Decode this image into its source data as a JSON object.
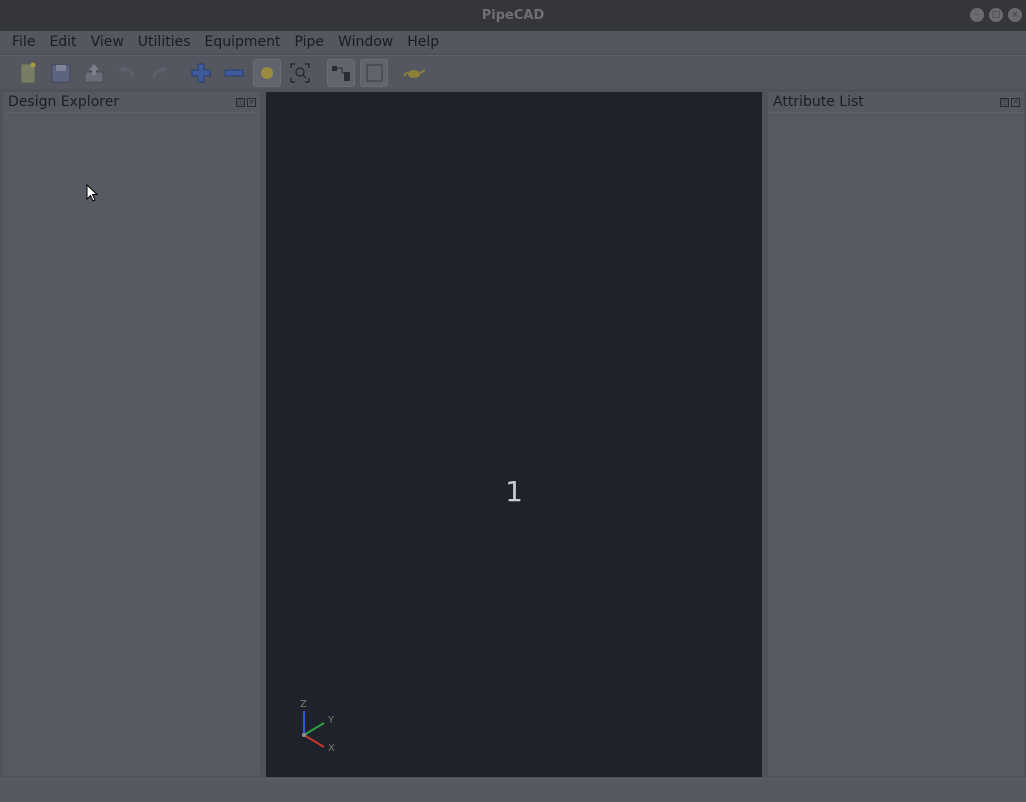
{
  "window": {
    "title": "PipeCAD",
    "controls": [
      "minimize",
      "maximize",
      "close"
    ]
  },
  "menubar": {
    "items": [
      "File",
      "Edit",
      "View",
      "Utilities",
      "Equipment",
      "Pipe",
      "Window",
      "Help"
    ]
  },
  "toolbar": {
    "buttons": [
      {
        "icon": "new-file-icon"
      },
      {
        "icon": "save-icon"
      },
      {
        "icon": "export-icon"
      },
      {
        "icon": "undo-icon"
      },
      {
        "icon": "redo-icon"
      },
      {
        "icon": "zoom-in-icon"
      },
      {
        "icon": "zoom-out-icon"
      },
      {
        "icon": "shaded-icon"
      },
      {
        "icon": "zoom-fit-icon"
      },
      {
        "icon": "pick-icon"
      },
      {
        "icon": "wireframe-icon"
      },
      {
        "icon": "teapot-icon"
      }
    ]
  },
  "panels": {
    "design_explorer": {
      "title": "Design Explorer"
    },
    "attribute_list": {
      "title": "Attribute List"
    }
  },
  "viewport": {
    "view_number": "1",
    "axis": {
      "z": "Z",
      "y": "Y",
      "x": "X"
    }
  },
  "colors": {
    "background": "#4f525a",
    "viewport": "#1f222a",
    "axis_x": "#c0392b",
    "axis_y": "#2ea043",
    "axis_z": "#2e5bd8"
  }
}
